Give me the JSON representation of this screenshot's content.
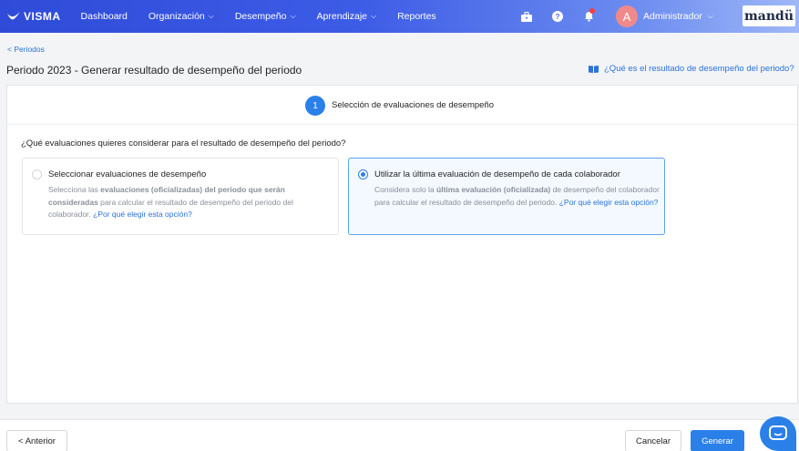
{
  "nav": {
    "brand": "VISMA",
    "items": [
      {
        "label": "Dashboard",
        "dropdown": false
      },
      {
        "label": "Organización",
        "dropdown": true
      },
      {
        "label": "Desempeño",
        "dropdown": true
      },
      {
        "label": "Aprendizaje",
        "dropdown": true
      },
      {
        "label": "Reportes",
        "dropdown": false
      }
    ],
    "user_initial": "A",
    "user_name": "Administrador",
    "logo": "mandü",
    "icons": [
      "briefcase-icon",
      "help-icon",
      "bell-icon"
    ]
  },
  "breadcrumb": "< Periodos",
  "page_title": "Periodo 2023 - Generar resultado de desempeño del periodo",
  "help_link": "¿Qué es el resultado de desempeño del periodo?",
  "step": {
    "number": "1",
    "label": "Selección de evaluaciones de desempeño"
  },
  "question": "¿Qué evaluaciones quieres considerar para el resultado de desempeño del periodo?",
  "options": [
    {
      "title": "Seleccionar evaluaciones de desempeño",
      "desc_a": "Selecciona las ",
      "desc_b": "evaluaciones (oficializadas) del periodo que serán consideradas",
      "desc_c": " para calcular el resultado de desempeño del periodo del colaborador. ",
      "link": "¿Por qué elegir esta opción?",
      "selected": false
    },
    {
      "title": "Utilizar la última evaluación de desempeño de cada colaborador",
      "desc_a": "Considera solo la ",
      "desc_b": "última evaluación (oficializada)",
      "desc_c": " de desempeño del colaborador para calcular el resultado de desempeño del periodo. ",
      "link": "¿Por qué elegir esta opción?",
      "selected": true
    }
  ],
  "footer": {
    "back": "< Anterior",
    "cancel": "Cancelar",
    "generate": "Generar"
  },
  "colors": {
    "accent": "#2a80e8",
    "link": "#2a73d8"
  }
}
